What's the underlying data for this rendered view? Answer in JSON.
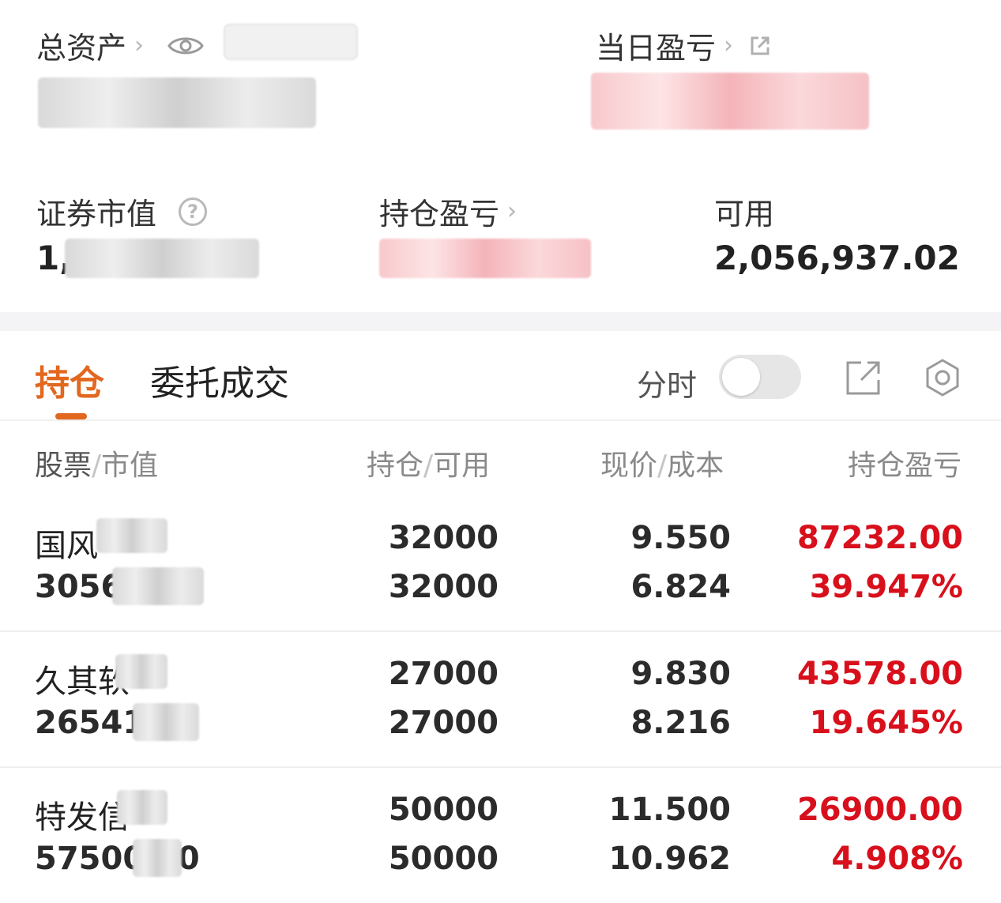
{
  "summary": {
    "total_assets_label": "总资产",
    "daily_pnl_label": "当日盈亏",
    "market_value_label": "证券市值",
    "market_value_partial": "1,",
    "position_pnl_label": "持仓盈亏",
    "available_label": "可用",
    "available_value": "2,056,937.02"
  },
  "tabs": {
    "positions": "持仓",
    "orders": "委托成交",
    "intraday_label": "分时"
  },
  "table_header": {
    "stock": "股票",
    "market_value": "市值",
    "holding": "持仓",
    "available": "可用",
    "price": "现价",
    "cost": "成本",
    "pnl": "持仓盈亏",
    "separator": "/"
  },
  "holdings": [
    {
      "name": "国风",
      "market_value_partial": "3056",
      "holding": "32000",
      "available": "32000",
      "price": "9.550",
      "cost": "6.824",
      "pnl": "87232.00",
      "pnl_pct": "39.947%"
    },
    {
      "name": "久其软",
      "market_value_partial": "265416",
      "holding": "27000",
      "available": "27000",
      "price": "9.830",
      "cost": "8.216",
      "pnl": "43578.00",
      "pnl_pct": "19.645%"
    },
    {
      "name": "特发信",
      "market_value_partial": "57500   00",
      "holding": "50000",
      "available": "50000",
      "price": "11.500",
      "cost": "10.962",
      "pnl": "26900.00",
      "pnl_pct": "4.908%"
    }
  ],
  "colors": {
    "accent": "#e2671f",
    "profit": "#d8101c"
  },
  "icons": [
    "eye-icon",
    "question-icon",
    "external-link-icon",
    "gear-icon",
    "chevron-right-icon"
  ]
}
